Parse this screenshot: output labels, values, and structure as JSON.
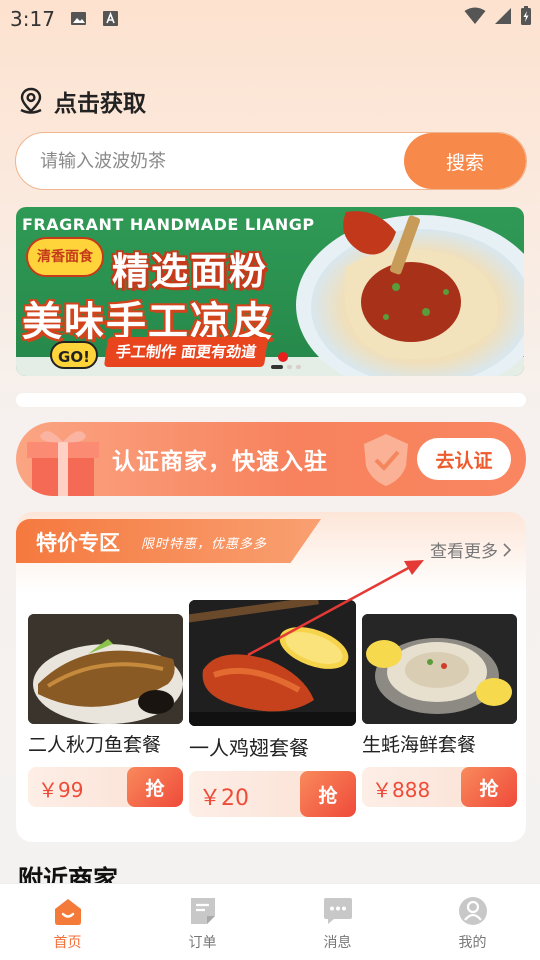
{
  "status_bar": {
    "time": "3:17"
  },
  "location": {
    "label": "点击获取"
  },
  "search": {
    "placeholder": "请输入波波奶茶",
    "button_label": "搜索"
  },
  "banner": {
    "top_text": "FRAGRANT HANDMADE LIANGP",
    "badge_text": "清香面食",
    "line1": "精选面粉",
    "line2": "美味手工凉皮",
    "tag": "手工制作 面更有劲道",
    "go_label": "GO!",
    "dots": 3,
    "active_dot": 0
  },
  "merchant": {
    "text": "认证商家，快速入驻",
    "button_label": "去认证"
  },
  "special": {
    "title": "特价专区",
    "subtitle": "限时特惠，优惠多多",
    "see_more": "查看更多",
    "products": [
      {
        "name": "二人秋刀鱼套餐",
        "price": "￥99",
        "grab": "抢"
      },
      {
        "name": "一人鸡翅套餐",
        "price": "￥20",
        "grab": "抢"
      },
      {
        "name": "生蚝海鲜套餐",
        "price": "￥888",
        "grab": "抢"
      }
    ]
  },
  "nearby": {
    "title": "附近商家"
  },
  "tabs": [
    {
      "label": "首页",
      "icon": "home-icon",
      "active": true
    },
    {
      "label": "订单",
      "icon": "order-icon",
      "active": false
    },
    {
      "label": "消息",
      "icon": "message-icon",
      "active": false
    },
    {
      "label": "我的",
      "icon": "profile-icon",
      "active": false
    }
  ],
  "colors": {
    "accent": "#f78a4a",
    "price": "#ee4c38",
    "active_tab": "#f2703a"
  }
}
